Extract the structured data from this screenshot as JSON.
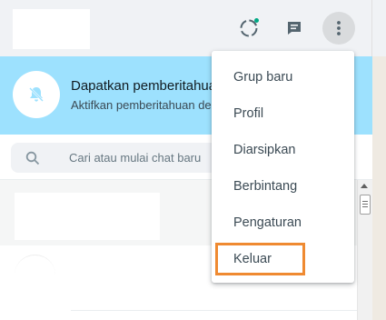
{
  "header": {
    "status_icon": "status-ring-icon",
    "new_chat_icon": "new-chat-icon",
    "menu_icon": "kebab-menu-icon",
    "status_dot_color": "#00a884"
  },
  "banner": {
    "title": "Dapatkan pemberitahuan",
    "subtitle": "Aktifkan pemberitahuan desktop",
    "icon": "bell-off-icon",
    "background": "#9de1fe"
  },
  "search": {
    "placeholder": "Cari atau mulai chat baru",
    "value": "",
    "icon": "search-icon"
  },
  "menu": {
    "items": [
      {
        "label": "Grup baru"
      },
      {
        "label": "Profil"
      },
      {
        "label": "Diarsipkan"
      },
      {
        "label": "Berbintang"
      },
      {
        "label": "Pengaturan"
      },
      {
        "label": "Keluar"
      }
    ],
    "highlighted_item": "Keluar",
    "highlight_color": "#ef8a31"
  }
}
